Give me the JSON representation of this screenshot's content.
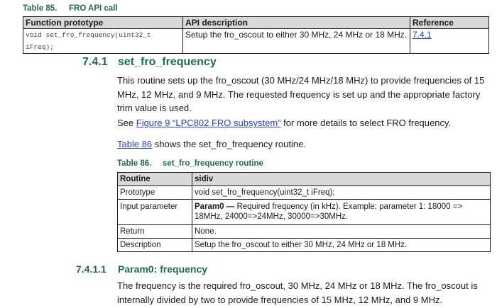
{
  "table85": {
    "caption_num": "Table 85.",
    "caption_title": "FRO API call",
    "headers": [
      "Function prototype",
      "API description",
      "Reference"
    ],
    "row": {
      "prototype": "void set_fro_frequency(uint32_t iFreq);",
      "description": "Setup the fro_oscout to either 30 MHz, 24 MHz or 18 MHz.",
      "reference": "7.4.1"
    }
  },
  "section": {
    "number": "7.4.1",
    "title": "set_fro_frequency",
    "para1": "This routine sets up the fro_oscout (30 MHz/24 MHz/18 MHz) to provide frequencies of 15 MHz, 12 MHz, and 9 MHz. The requested frequency is set up and the appropriate factory trim value is used.",
    "para2_pre": "See ",
    "para2_link": "Figure 9 “LPC802 FRO subsystem”",
    "para2_post": " for more details to select FRO frequency.",
    "para3_link": "Table 86",
    "para3_post": " shows the set_fro_frequency routine."
  },
  "table86": {
    "caption_num": "Table 86.",
    "caption_title": "set_fro_frequency routine",
    "headers": [
      "Routine",
      "sidiv"
    ],
    "rows": [
      {
        "label": "Prototype",
        "value": "void set_fro_frequency(uint32_t iFreq);"
      },
      {
        "label": "Input parameter",
        "value_bold": "Param0 —",
        "value": " Required frequency (in kHz). Example: parameter 1: 18000 => 18MHz, 24000=>24MHz, 30000=>30MHz."
      },
      {
        "label": "Return",
        "value": "None."
      },
      {
        "label": "Description",
        "value": "Setup the fro_oscout to either 30 MHz, 24 MHz or 18 MHz."
      }
    ]
  },
  "subsection": {
    "number": "7.4.1.1",
    "title": "Param0: frequency",
    "para": "The frequency is the required fro_oscout, 30 MHz, 24 MHz or 18 MHz. The fro_oscout is internally divided by two to provide frequencies of 15 MHz, 12 MHz, and 9 MHz."
  }
}
